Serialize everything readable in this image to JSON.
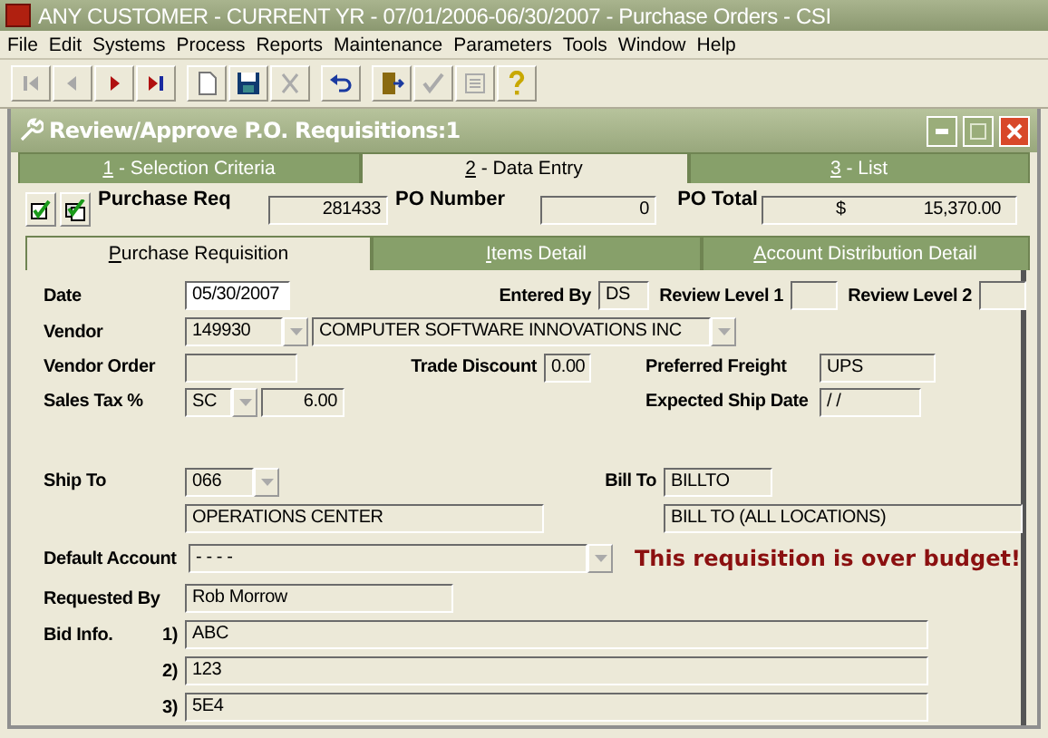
{
  "window": {
    "title": "ANY CUSTOMER - CURRENT YR - 07/01/2006-06/30/2007 - Purchase Orders - CSI"
  },
  "menu": [
    "File",
    "Edit",
    "Systems",
    "Process",
    "Reports",
    "Maintenance",
    "Parameters",
    "Tools",
    "Window",
    "Help"
  ],
  "toolbar": [
    {
      "kind": "first",
      "disabled": true
    },
    {
      "kind": "previous",
      "disabled": true
    },
    {
      "kind": "next",
      "disabled": false
    },
    {
      "kind": "last",
      "disabled": false
    },
    {
      "kind": "new",
      "disabled": false
    },
    {
      "kind": "save",
      "disabled": false
    },
    {
      "kind": "cut",
      "disabled": true
    },
    {
      "kind": "undo",
      "disabled": false
    },
    {
      "kind": "exit",
      "disabled": false
    },
    {
      "kind": "approve",
      "disabled": true
    },
    {
      "kind": "document",
      "disabled": true
    },
    {
      "kind": "help",
      "disabled": false
    }
  ],
  "child_window": {
    "title": "Review/Approve P.O. Requisitions:1"
  },
  "tabs": [
    {
      "label": "1 - Selection Criteria",
      "selected": false
    },
    {
      "label": "2 - Data Entry",
      "selected": true
    },
    {
      "label": "3 - List",
      "selected": false
    }
  ],
  "header": {
    "purchase_req": {
      "label": "Purchase Req",
      "value": "281433"
    },
    "po_number": {
      "label": "PO Number",
      "value": "0"
    },
    "po_total": {
      "label": "PO Total",
      "currency": "$",
      "value": "15,370.00"
    }
  },
  "subtabs": [
    {
      "label": "Purchase Requisition",
      "selected": true
    },
    {
      "label": "Items Detail",
      "selected": false
    },
    {
      "label": "Account Distribution Detail",
      "selected": false
    }
  ],
  "form": {
    "date": {
      "label": "Date",
      "value": "05/30/2007"
    },
    "entered_by": {
      "label": "Entered By",
      "value": "DS"
    },
    "review_level_1": {
      "label": "Review Level 1"
    },
    "review_level_2": {
      "label": "Review Level 2"
    },
    "vendor": {
      "label": "Vendor",
      "code": "149930",
      "name": "COMPUTER SOFTWARE INNOVATIONS INC"
    },
    "vendor_order": {
      "label": "Vendor Order"
    },
    "trade_discount": {
      "label": "Trade Discount",
      "value": "0.00"
    },
    "preferred_freight": {
      "label": "Preferred Freight",
      "value": "UPS"
    },
    "sales_tax": {
      "label": "Sales Tax %",
      "code": "SC",
      "value": "6.00"
    },
    "expected_ship_date": {
      "label": "Expected Ship Date",
      "value": "/ /"
    },
    "ship_to": {
      "label": "Ship To",
      "code": "066",
      "name": "OPERATIONS CENTER"
    },
    "bill_to": {
      "label": "Bill To",
      "code": "BILLTO",
      "name": "BILL TO (ALL LOCATIONS)"
    },
    "default_account": {
      "label": "Default Account",
      "value": "- - - -"
    },
    "message": "This requisition is over budget!",
    "requested_by": {
      "label": "Requested By",
      "value": "Rob Morrow"
    },
    "bid_info": {
      "label": "Bid Info.",
      "items": [
        {
          "number": "1)",
          "value": "ABC"
        },
        {
          "number": "2)",
          "value": "123"
        },
        {
          "number": "3)",
          "value": "5E4"
        }
      ]
    }
  }
}
